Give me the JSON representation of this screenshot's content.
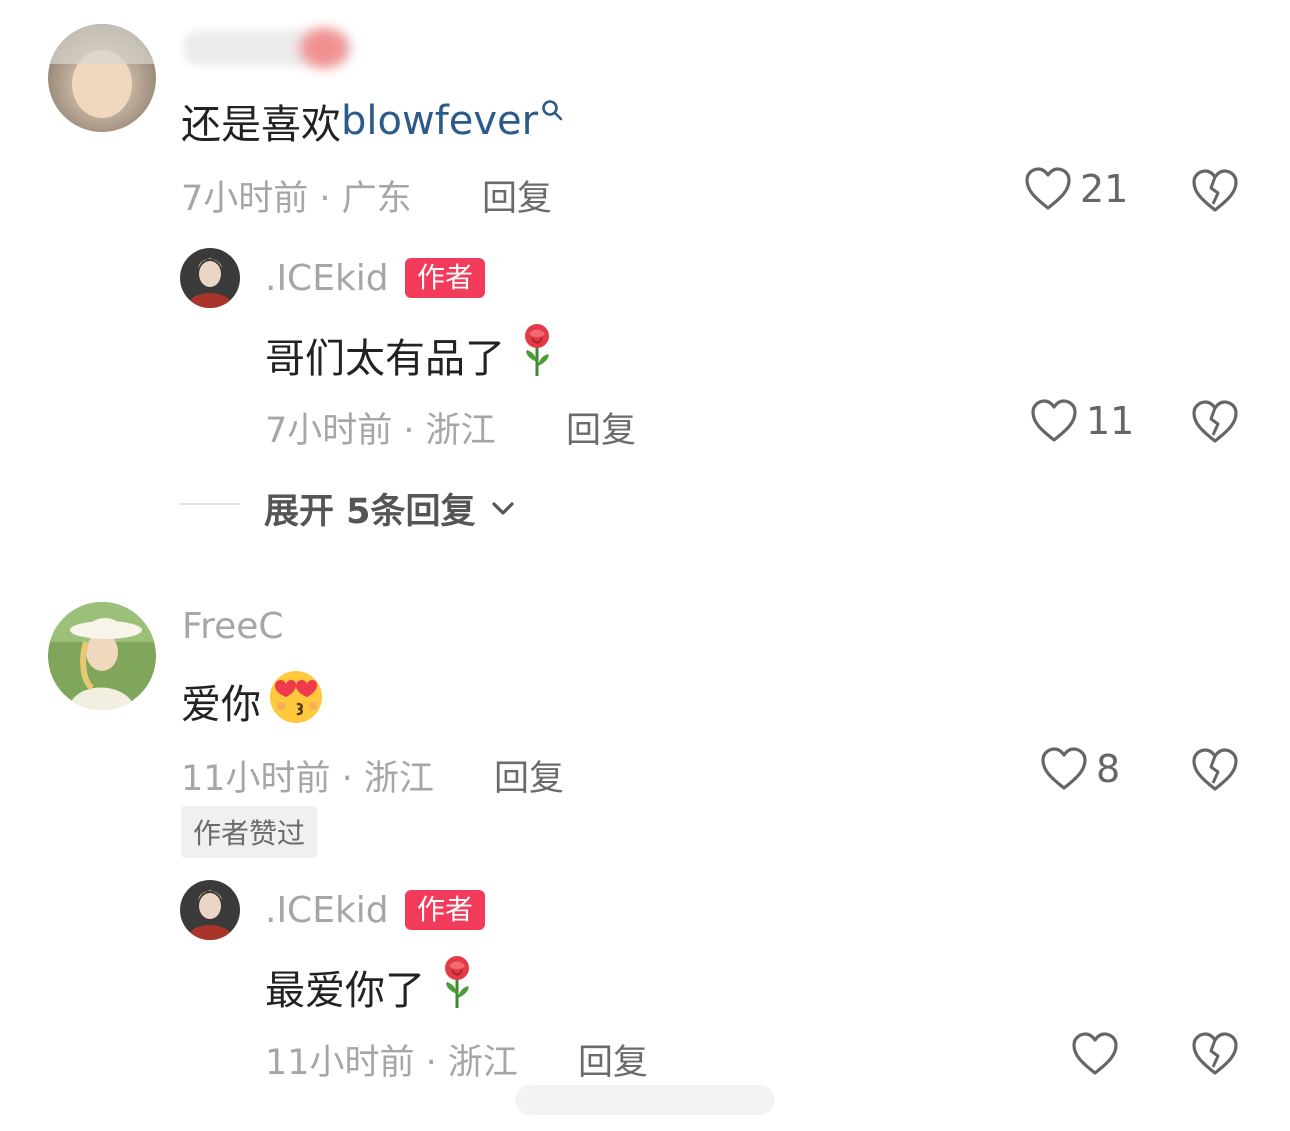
{
  "comments": [
    {
      "text_before": "还是喜欢",
      "link": "blowfever",
      "meta": "7小时前 · 广东",
      "reply": "回复",
      "likes": "21",
      "replies": [
        {
          "name": ".ICEkid",
          "badge": "作者",
          "text": "哥们太有品了",
          "meta": "7小时前 · 浙江",
          "reply": "回复",
          "likes": "11"
        }
      ],
      "expand": "展开 5条回复"
    },
    {
      "name": "FreeC",
      "text": "爱你",
      "meta": "11小时前 · 浙江",
      "reply": "回复",
      "likes": "8",
      "tag": "作者赞过",
      "replies": [
        {
          "name": ".ICEkid",
          "badge": "作者",
          "text": "最爱你了",
          "meta": "11小时前 · 浙江",
          "reply": "回复"
        }
      ]
    }
  ],
  "colors": {
    "badge": "#f23a5a",
    "link": "#2c5a8a",
    "meta": "#a6a6a6"
  },
  "icons": [
    "heart-icon",
    "broken-heart-icon",
    "search-icon",
    "chevron-down-icon",
    "rose-emoji",
    "kiss-emoji"
  ]
}
